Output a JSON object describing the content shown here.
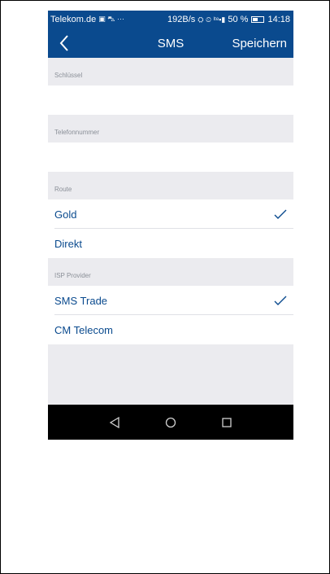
{
  "status_bar": {
    "carrier": "Telekom.de",
    "left_icons": "▣ ⛍ ···",
    "speed": "192B/s",
    "network": "⛭ ⏲ ˡᵗᵉ▪▮",
    "battery_percent": "50 %",
    "time": "14:18"
  },
  "header": {
    "title": "SMS",
    "save_label": "Speichern"
  },
  "form": {
    "key_label": "Schlüssel",
    "key_value": "",
    "phone_label": "Telefonnummer",
    "phone_value": ""
  },
  "route": {
    "label": "Route",
    "options": [
      {
        "label": "Gold",
        "selected": true
      },
      {
        "label": "Direkt",
        "selected": false
      }
    ]
  },
  "isp": {
    "label": "ISP Provider",
    "options": [
      {
        "label": "SMS Trade",
        "selected": true
      },
      {
        "label": "CM Telecom",
        "selected": false
      }
    ]
  },
  "colors": {
    "primary": "#0a4a8e",
    "background": "#ebebef",
    "label_gray": "#8a8f97"
  }
}
